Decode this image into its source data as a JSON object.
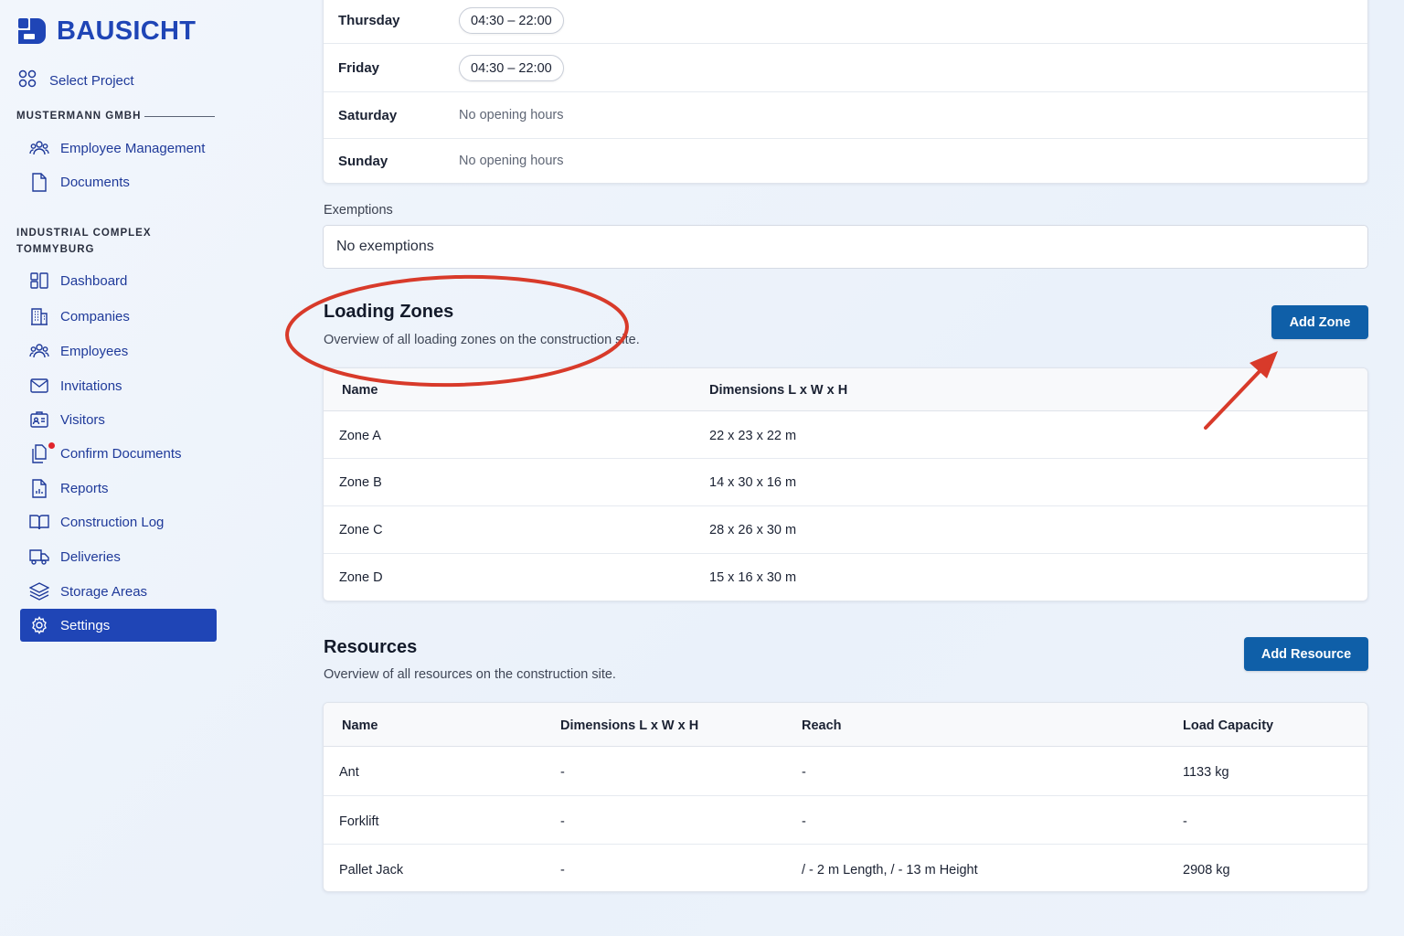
{
  "brand": {
    "name": "BAUSICHT"
  },
  "sidebar": {
    "select_project": "Select Project",
    "org_label": "MUSTERMANN GMBH",
    "org_items": [
      {
        "label": "Employee Management",
        "icon": "users-icon"
      },
      {
        "label": "Documents",
        "icon": "document-icon"
      }
    ],
    "project_label_line1": "INDUSTRIAL COMPLEX",
    "project_label_line2": "TOMMYBURG",
    "project_items": [
      {
        "label": "Dashboard",
        "icon": "dashboard-icon"
      },
      {
        "label": "Companies",
        "icon": "building-icon"
      },
      {
        "label": "Employees",
        "icon": "users-icon"
      },
      {
        "label": "Invitations",
        "icon": "mail-icon"
      },
      {
        "label": "Visitors",
        "icon": "id-card-icon"
      },
      {
        "label": "Confirm Documents",
        "icon": "documents-icon"
      },
      {
        "label": "Reports",
        "icon": "report-icon"
      },
      {
        "label": "Construction Log",
        "icon": "book-icon"
      },
      {
        "label": "Deliveries",
        "icon": "truck-icon"
      },
      {
        "label": "Storage Areas",
        "icon": "layers-icon"
      },
      {
        "label": "Settings",
        "icon": "gear-icon",
        "active": true
      }
    ]
  },
  "opening_hours": [
    {
      "day": "Thursday",
      "hours": "04:30 – 22:00"
    },
    {
      "day": "Friday",
      "hours": "04:30 – 22:00"
    },
    {
      "day": "Saturday",
      "hours": "No opening hours"
    },
    {
      "day": "Sunday",
      "hours": "No opening hours"
    }
  ],
  "exemptions": {
    "label": "Exemptions",
    "value": "No exemptions"
  },
  "loading_zones": {
    "title": "Loading Zones",
    "subtitle": "Overview of all loading zones on the construction site.",
    "add_button": "Add Zone",
    "columns": [
      "Name",
      "Dimensions L x W x H"
    ],
    "rows": [
      [
        "Zone A",
        "22 x 23 x 22 m"
      ],
      [
        "Zone B",
        "14 x 30 x 16 m"
      ],
      [
        "Zone C",
        "28 x 26 x 30 m"
      ],
      [
        "Zone D",
        "15 x 16 x 30 m"
      ]
    ]
  },
  "resources": {
    "title": "Resources",
    "subtitle": "Overview of all resources on the construction site.",
    "add_button": "Add Resource",
    "columns": [
      "Name",
      "Dimensions L x W x H",
      "Reach",
      "Load Capacity"
    ],
    "rows": [
      [
        "Ant",
        "-",
        "-",
        "1133 kg"
      ],
      [
        "Forklift",
        "-",
        "-",
        "-"
      ],
      [
        "Pallet Jack",
        "-",
        "/ - 2 m Length, / - 13 m Height",
        "2908 kg"
      ]
    ]
  },
  "colors": {
    "brand": "#1f45b6",
    "button": "#0f5fa8",
    "annotation": "#d83a2a",
    "badge": "#e0242c"
  }
}
